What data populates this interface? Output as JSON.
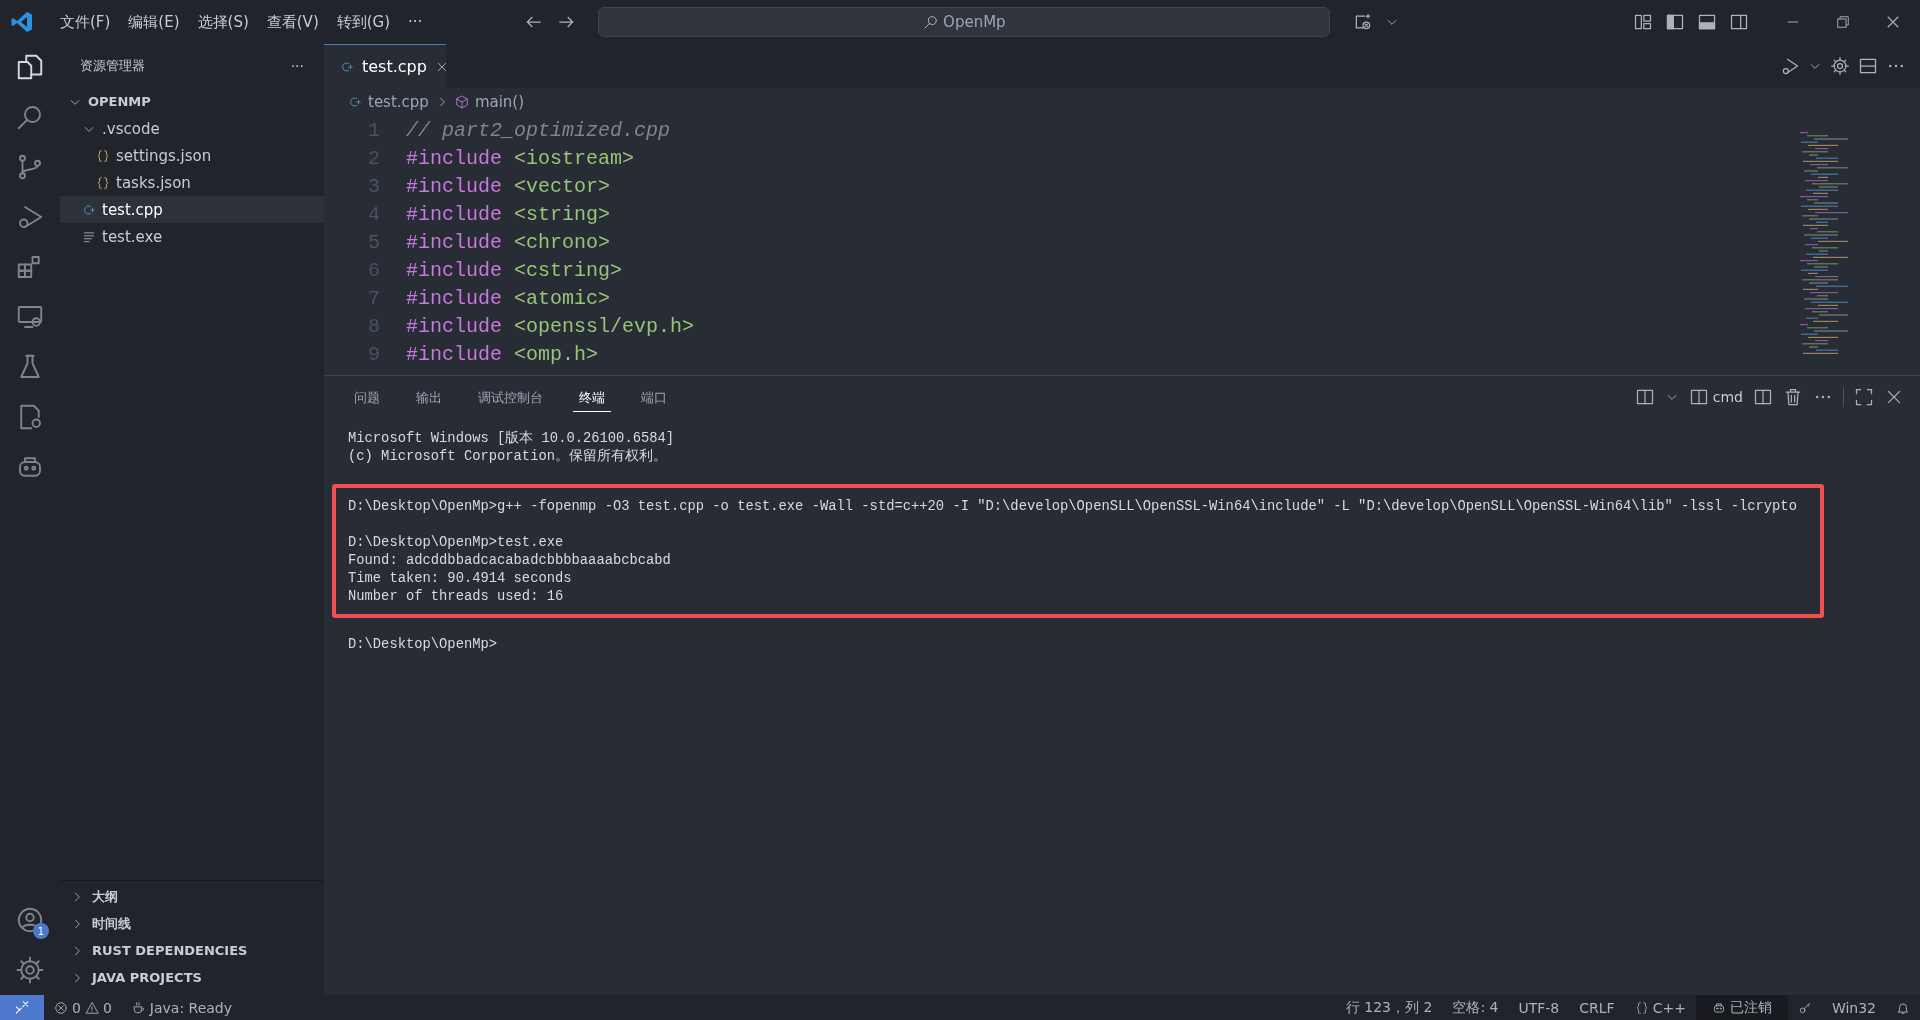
{
  "menu": [
    "文件(F)",
    "编辑(E)",
    "选择(S)",
    "查看(V)",
    "转到(G)",
    "···"
  ],
  "search": {
    "value": "OpenMp"
  },
  "explorer": {
    "title": "资源管理器",
    "more": "···",
    "root": {
      "name": "OPENMP",
      "expanded": true,
      "children": [
        {
          "name": ".vscode",
          "kind": "folder",
          "expanded": true,
          "selected": false,
          "children": [
            {
              "name": "settings.json",
              "kind": "json",
              "selected": false
            },
            {
              "name": "tasks.json",
              "kind": "json",
              "selected": false
            }
          ]
        },
        {
          "name": "test.cpp",
          "kind": "cpp",
          "selected": true
        },
        {
          "name": "test.exe",
          "kind": "file",
          "selected": false
        }
      ]
    },
    "sections": [
      {
        "title": "大纲",
        "expanded": false
      },
      {
        "title": "时间线",
        "expanded": false
      },
      {
        "title": "RUST DEPENDENCIES",
        "expanded": false
      },
      {
        "title": "JAVA PROJECTS",
        "expanded": false
      }
    ]
  },
  "tabs": [
    {
      "label": "test.cpp",
      "selected": true
    }
  ],
  "breadcrumbs": [
    {
      "label": "test.cpp",
      "kind": "cpp"
    },
    {
      "label": "main()",
      "kind": "function"
    }
  ],
  "code": [
    {
      "number": "1",
      "tokens": [
        {
          "kind": "comment",
          "text": "// part2_optimized.cpp"
        }
      ]
    },
    {
      "number": "2",
      "tokens": [
        {
          "kind": "directive",
          "text": "#include"
        },
        {
          "kind": "header",
          "text": "<iostream>"
        }
      ]
    },
    {
      "number": "3",
      "tokens": [
        {
          "kind": "directive",
          "text": "#include"
        },
        {
          "kind": "header",
          "text": "<vector>"
        }
      ]
    },
    {
      "number": "4",
      "tokens": [
        {
          "kind": "directive",
          "text": "#include"
        },
        {
          "kind": "header",
          "text": "<string>"
        }
      ]
    },
    {
      "number": "5",
      "tokens": [
        {
          "kind": "directive",
          "text": "#include"
        },
        {
          "kind": "header",
          "text": "<chrono>"
        }
      ]
    },
    {
      "number": "6",
      "tokens": [
        {
          "kind": "directive",
          "text": "#include"
        },
        {
          "kind": "header",
          "text": "<cstring>"
        }
      ]
    },
    {
      "number": "7",
      "tokens": [
        {
          "kind": "directive",
          "text": "#include"
        },
        {
          "kind": "header",
          "text": "<atomic>"
        }
      ]
    },
    {
      "number": "8",
      "tokens": [
        {
          "kind": "directive",
          "text": "#include"
        },
        {
          "kind": "header",
          "text": "<openssl/evp.h>"
        }
      ]
    },
    {
      "number": "9",
      "tokens": [
        {
          "kind": "directive",
          "text": "#include"
        },
        {
          "kind": "header",
          "text": "<omp.h>"
        }
      ]
    }
  ],
  "panel": {
    "tabs": [
      {
        "label": "问题",
        "selected": false
      },
      {
        "label": "输出",
        "selected": false
      },
      {
        "label": "调试控制台",
        "selected": false
      },
      {
        "label": "终端",
        "selected": true
      },
      {
        "label": "端口",
        "selected": false
      }
    ],
    "terminal_name": "cmd",
    "blocks": [
      {
        "highlighted": false,
        "groups": [
          [
            "Microsoft Windows [版本 10.0.26100.6584]",
            "(c) Microsoft Corporation。保留所有权利。"
          ]
        ]
      },
      {
        "highlighted": true,
        "groups": [
          [
            "D:\\Desktop\\OpenMp>g++ -fopenmp -O3 test.cpp -o test.exe -Wall -std=c++20 -I \"D:\\develop\\OpenSLL\\OpenSSL-Win64\\include\" -L \"D:\\develop\\OpenSLL\\OpenSSL-Win64\\lib\" -lssl -lcrypto"
          ],
          [
            "D:\\Desktop\\OpenMp>test.exe",
            "Found: adcddbbadcacabadcbbbbaaaabcbcabd",
            "Time taken: 90.4914 seconds",
            "Number of threads used: 16"
          ]
        ]
      },
      {
        "highlighted": false,
        "groups": [
          [
            "D:\\Desktop\\OpenMp>"
          ]
        ]
      }
    ]
  },
  "accounts_badge": "1",
  "status_bar": {
    "errors": "0",
    "warnings": "0",
    "java": "Java: Ready",
    "right": [
      {
        "kind": "text",
        "text": "行 123，列 2"
      },
      {
        "kind": "text",
        "text": "空格: 4"
      },
      {
        "kind": "text",
        "text": "UTF-8"
      },
      {
        "kind": "text",
        "text": "CRLF"
      },
      {
        "kind": "language",
        "text": "C++"
      },
      {
        "kind": "account",
        "text": "已注销"
      },
      {
        "kind": "key"
      },
      {
        "kind": "text",
        "text": "Win32"
      },
      {
        "kind": "bell"
      }
    ]
  }
}
